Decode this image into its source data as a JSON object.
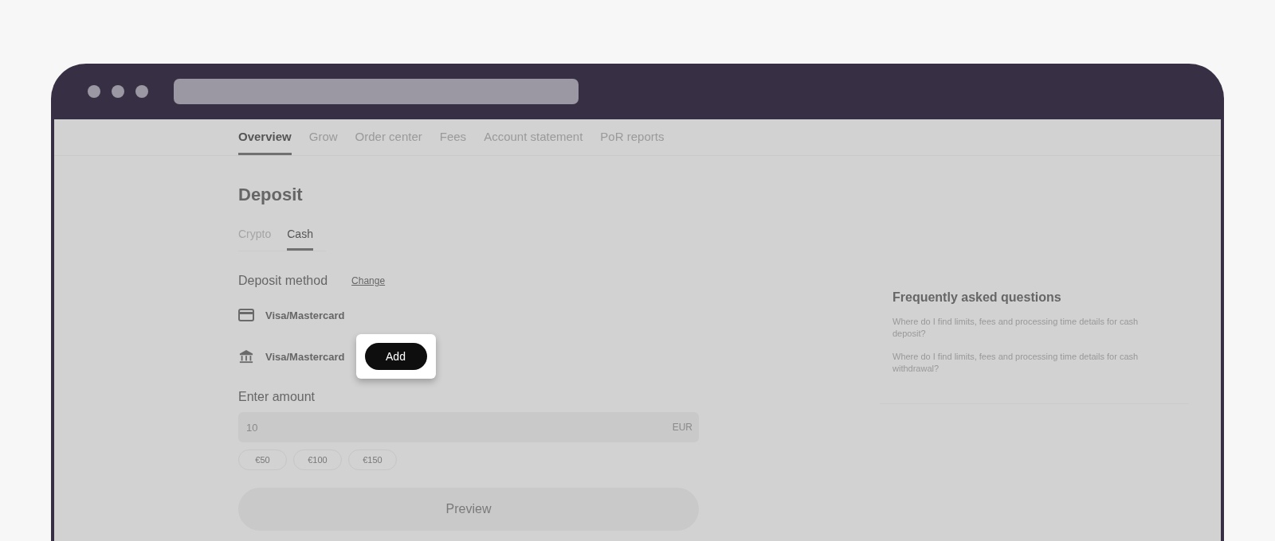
{
  "nav_tabs": [
    {
      "label": "Overview",
      "selected": true
    },
    {
      "label": "Grow",
      "selected": false
    },
    {
      "label": "Order center",
      "selected": false
    },
    {
      "label": "Fees",
      "selected": false
    },
    {
      "label": "Account statement",
      "selected": false
    },
    {
      "label": "PoR reports",
      "selected": false
    }
  ],
  "page_title": "Deposit",
  "method_tabs": [
    {
      "label": "Crypto",
      "selected": false
    },
    {
      "label": "Cash",
      "selected": true
    }
  ],
  "deposit_method": {
    "label": "Deposit method",
    "change_link": "Change"
  },
  "methods": [
    {
      "kind": "card",
      "label": "Visa/Mastercard"
    },
    {
      "kind": "bank",
      "label": "Visa/Mastercard",
      "action": "Add"
    }
  ],
  "amount": {
    "label": "Enter amount",
    "value": "10",
    "currency": "EUR"
  },
  "quick_amounts": [
    "€50",
    "€100",
    "€150"
  ],
  "preview_button": {
    "label": "Preview",
    "disabled": true
  },
  "faq": {
    "title": "Frequently asked questions",
    "questions": [
      "Where do I find limits, fees and processing time details for cash deposit?",
      "Where do I find limits, fees and processing time details for cash withdrawal?"
    ]
  }
}
